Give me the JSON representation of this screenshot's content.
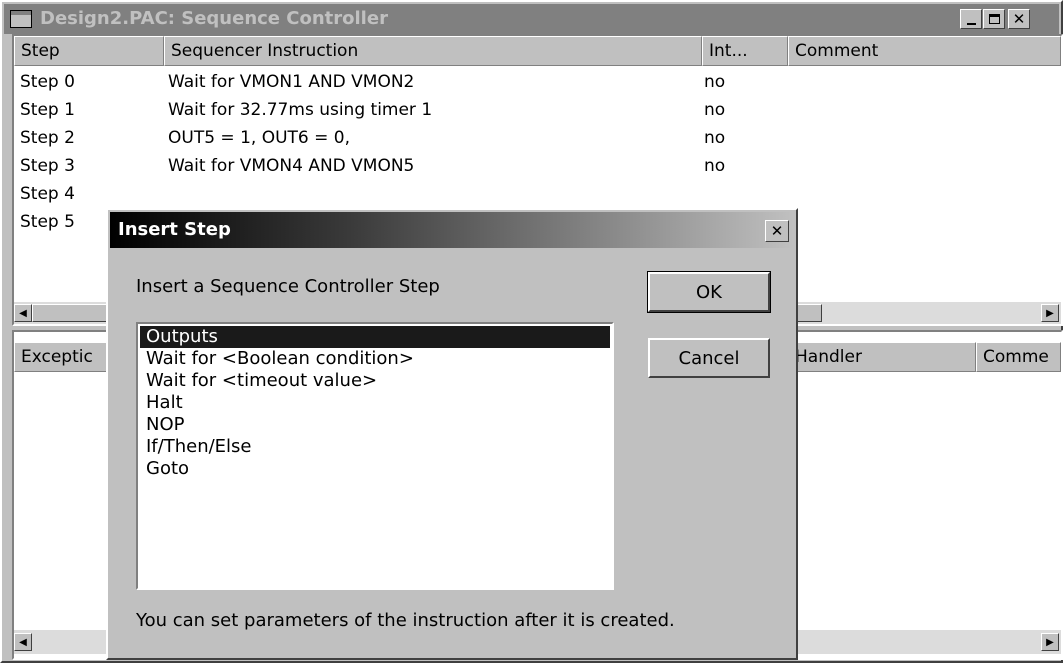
{
  "window": {
    "title": "Design2.PAC: Sequence Controller",
    "controls": [
      "minimize",
      "maximize",
      "close"
    ]
  },
  "steps_table": {
    "columns": [
      "Step",
      "Sequencer Instruction",
      "Int...",
      "Comment"
    ],
    "rows": [
      {
        "step": "Step 0",
        "instruction": "Wait for  VMON1 AND VMON2",
        "int": "no",
        "comment": ""
      },
      {
        "step": "Step 1",
        "instruction": "Wait for 32.77ms using timer 1",
        "int": "no",
        "comment": ""
      },
      {
        "step": "Step 2",
        "instruction": "OUT5 = 1, OUT6 = 0,",
        "int": "no",
        "comment": ""
      },
      {
        "step": "Step 3",
        "instruction": "Wait for  VMON4 AND VMON5",
        "int": "no",
        "comment": ""
      },
      {
        "step": "Step 4",
        "instruction": "",
        "int": "",
        "comment": ""
      },
      {
        "step": "Step 5",
        "instruction": "",
        "int": "",
        "comment": ""
      }
    ]
  },
  "exceptions_table": {
    "columns": [
      "Exceptic",
      "Handler",
      "Comme"
    ]
  },
  "dialog": {
    "title": "Insert Step",
    "prompt": "Insert a Sequence Controller Step",
    "ok_label": "OK",
    "cancel_label": "Cancel",
    "options": [
      "Outputs",
      "Wait for <Boolean condition>",
      "Wait for <timeout value>",
      "Halt",
      "NOP",
      "If/Then/Else",
      "Goto"
    ],
    "selected_option": "Outputs",
    "footer": "You can set parameters of the instruction after it is created."
  },
  "colors": {
    "title_bar_inactive": "#808080",
    "title_text_inactive": "#c0c0c0",
    "dialog_title_active_start": "#000000",
    "dialog_title_active_end": "#c0c0c0",
    "selection": "#1a1a1a",
    "face": "#c0c0c0"
  }
}
